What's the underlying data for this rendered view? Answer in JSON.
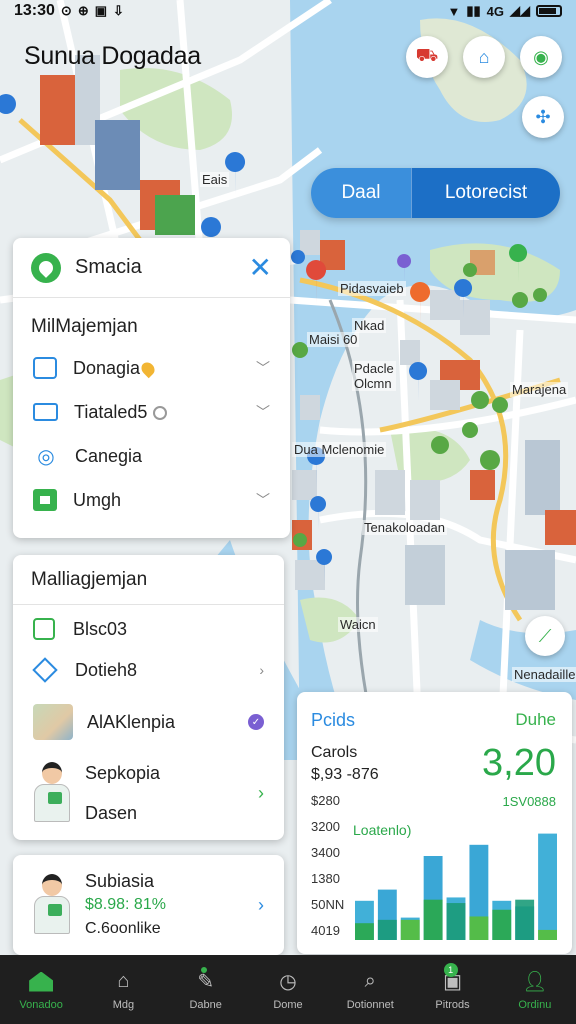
{
  "status_bar": {
    "time": "13:30",
    "signal": "4G"
  },
  "header": {
    "title": "Sunua Dogadaa"
  },
  "toggle": {
    "left": "Daal",
    "right": "Lotorecist"
  },
  "map_labels": [
    "Eais",
    "Pidasvaieb",
    "Nkad",
    "Maisi 60",
    "Pdacle\nOlcmn",
    "Marajena",
    "Dua Mclenomie",
    "Tenakoloadan",
    "Waicn",
    "Nenadaille"
  ],
  "filter_card": {
    "title": "Smacia",
    "subtitle": "MilMajemjan",
    "items": [
      {
        "label": "Donagia",
        "icon": "calendar-icon"
      },
      {
        "label": "Tiataled5",
        "icon": "mail-icon"
      },
      {
        "label": "Canegia",
        "icon": "location-pin-icon"
      },
      {
        "label": "Umgh",
        "icon": "green-square-icon"
      }
    ]
  },
  "list_card": {
    "title": "Malliagjemjan",
    "items": [
      {
        "label": "Blsc03"
      },
      {
        "label": "Dotieh8"
      },
      {
        "label": "AlAKlenpia"
      },
      {
        "label": "Sepkopia"
      },
      {
        "label": "Dasen"
      }
    ]
  },
  "summary_card": {
    "title": "Subiasia",
    "price": "$8.98: 81%",
    "subtitle": "C.6oonlike"
  },
  "stats_card": {
    "title": "Pcids",
    "right_label": "Duhe",
    "cards_label": "Carols",
    "range": "$,93 -876",
    "big_value": "3,20",
    "sub_value": "1SV0888",
    "chart_label": "Loatenlo)"
  },
  "chart_data": {
    "type": "bar",
    "y_ticks": [
      "$280",
      "3200",
      "3400",
      "1380",
      "50NN",
      "4019"
    ],
    "series": [
      {
        "name": "blue",
        "values": [
          0.35,
          0.45,
          0.2,
          0.75,
          0.38,
          0.85,
          0.35,
          0.3,
          0.95
        ]
      },
      {
        "name": "green",
        "values": [
          0.25,
          0.3,
          0.3,
          0.6,
          0.55,
          0.35,
          0.45,
          0.6,
          0.15
        ]
      }
    ]
  },
  "nav": {
    "items": [
      {
        "label": "Vonadoo"
      },
      {
        "label": "Mdg"
      },
      {
        "label": "Dabne"
      },
      {
        "label": "Dome"
      },
      {
        "label": "Dotionnet"
      },
      {
        "label": "Pitrods"
      },
      {
        "label": "Ordinu"
      }
    ]
  },
  "colors": {
    "accent_blue": "#2b8be0",
    "accent_green": "#37b24d",
    "nav_bg": "#1f1f1f"
  }
}
